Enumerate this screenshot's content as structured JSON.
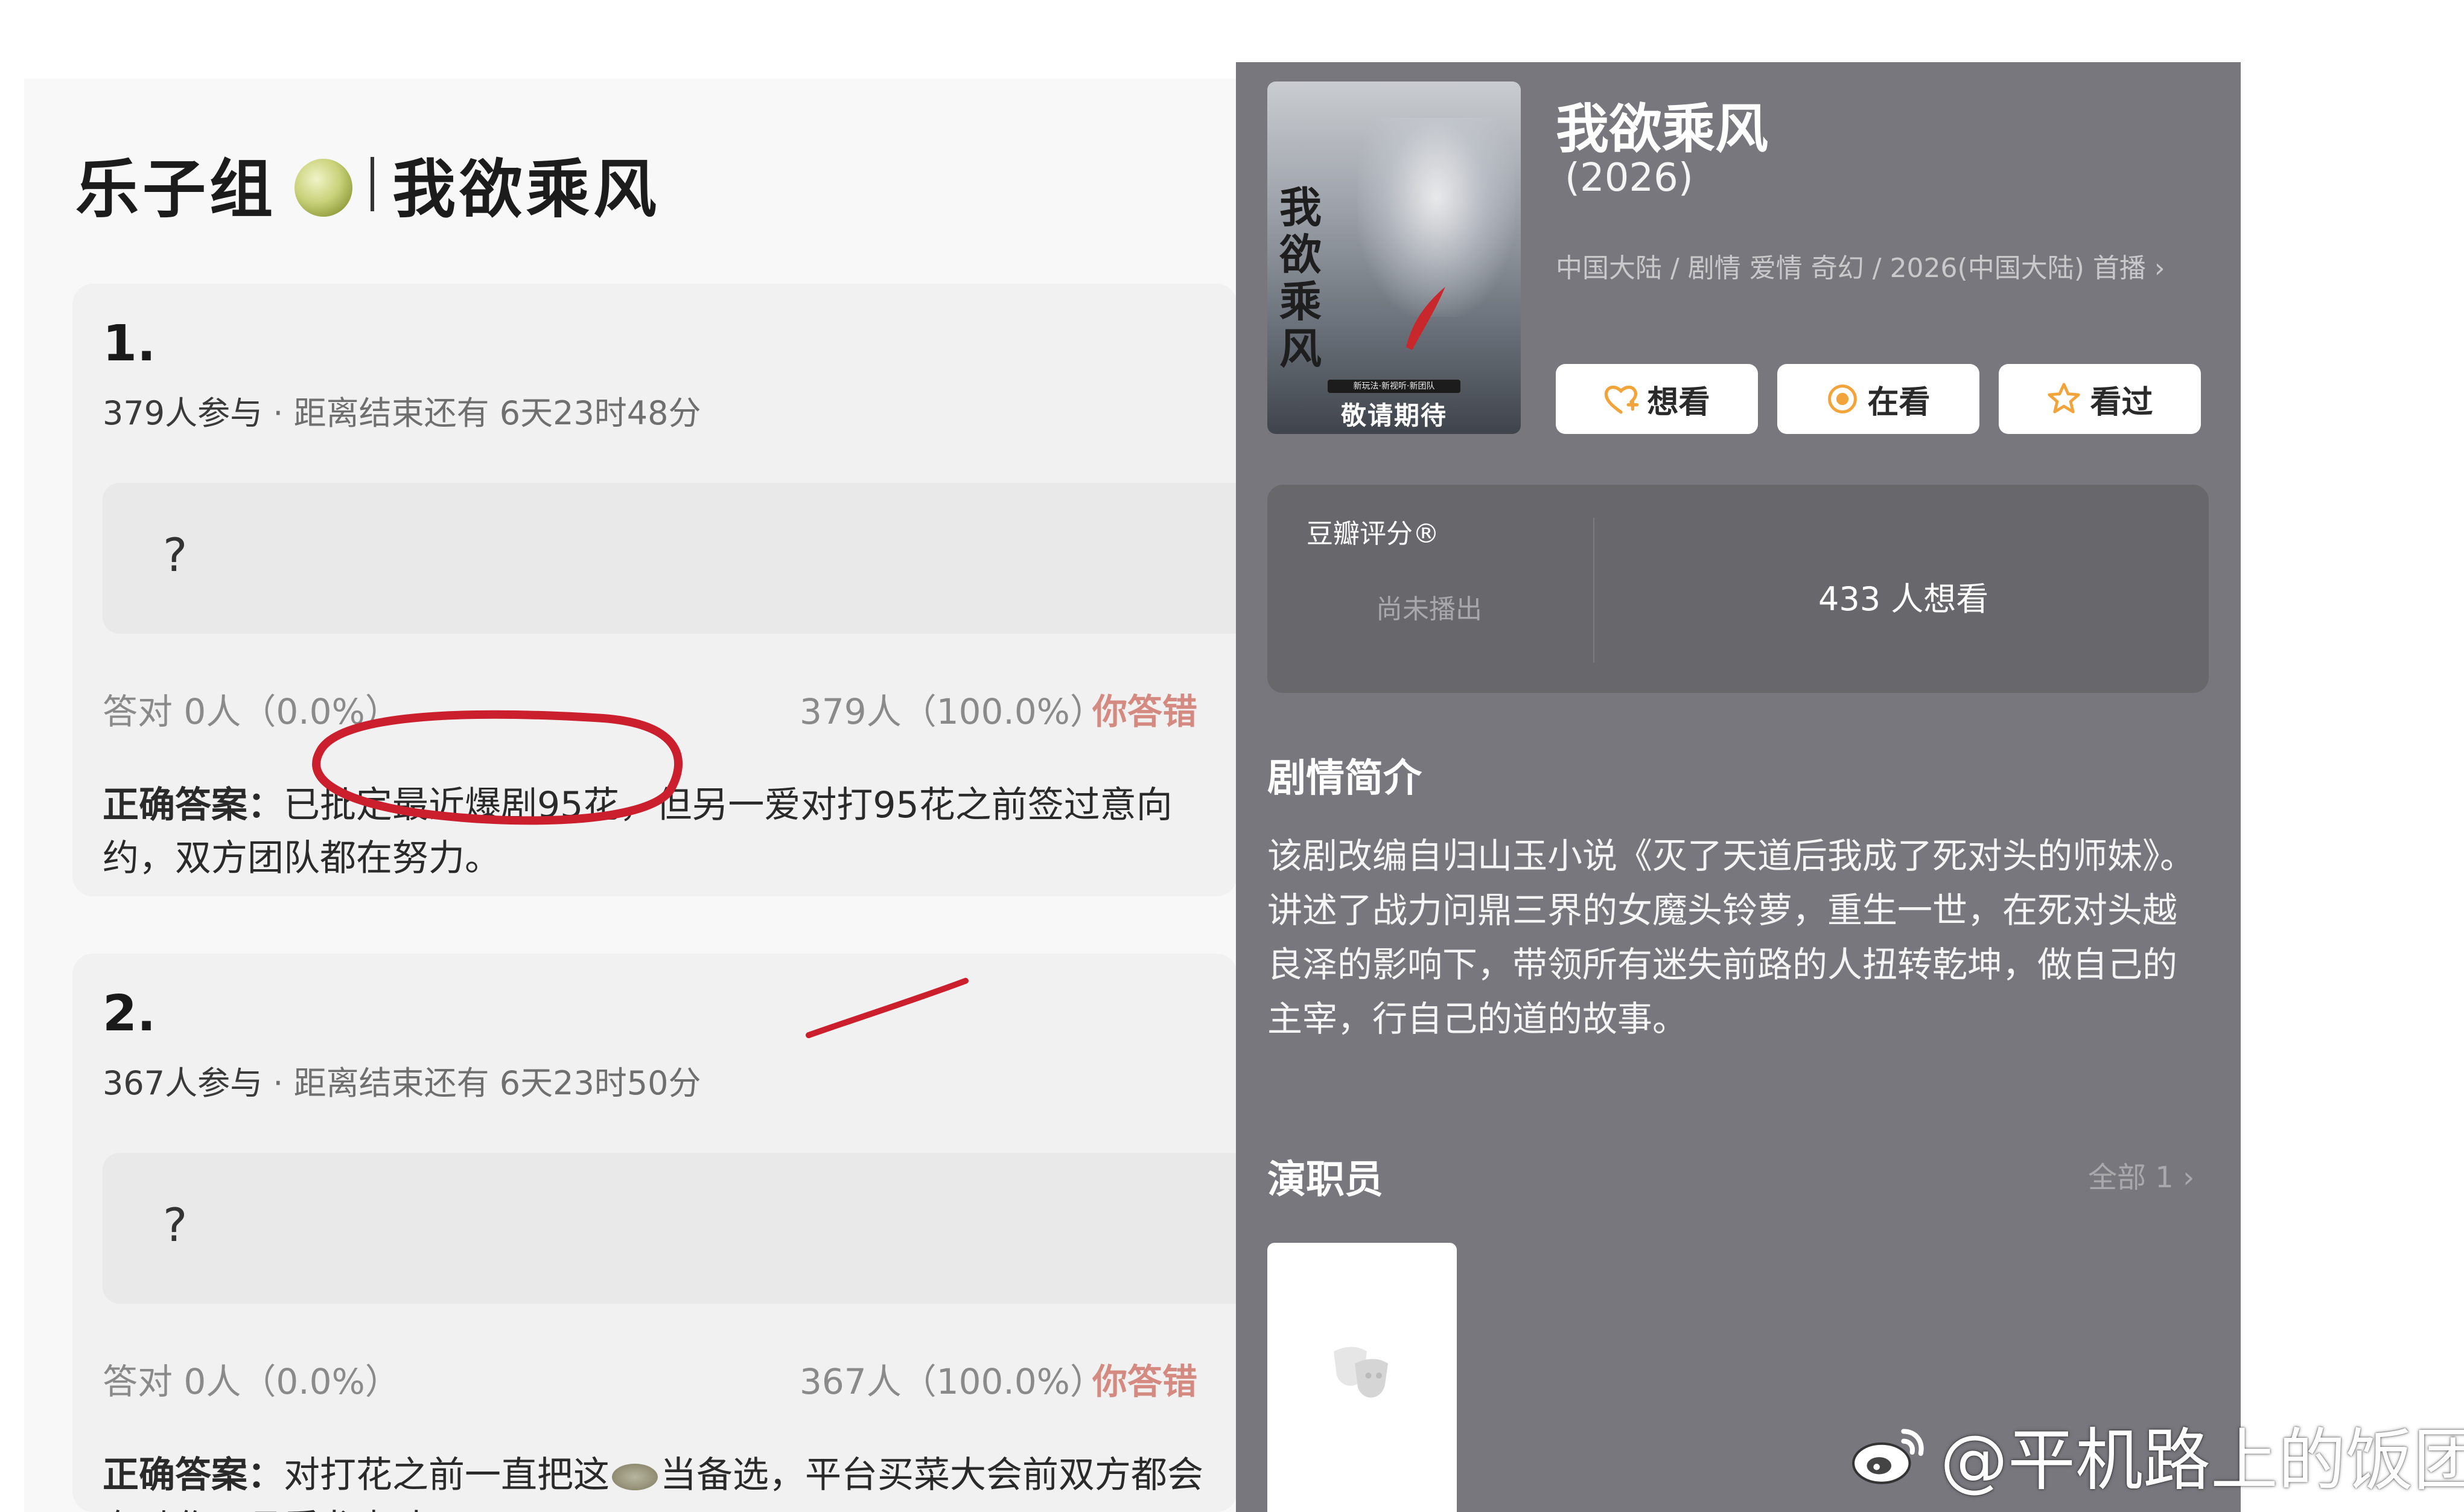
{
  "left": {
    "header": {
      "group_name": "乐子组",
      "drama_title": "我欲乘风"
    },
    "questions": [
      {
        "number": "1.",
        "participants": "379人参与",
        "separator": " · ",
        "deadline": "距离结束还有 6天23时48分",
        "question_text": "?",
        "correct_stats": "答对  0人（0.0%）",
        "wrong_stats": "379人（100.0%）",
        "wrong_label": "你答错",
        "answer_label": "正确答案：",
        "answer_text": "已批定最近爆剧95花，但另一爱对打95花之前签过意向约，双方团队都在努力。"
      },
      {
        "number": "2.",
        "participants": "367人参与",
        "separator": " · ",
        "deadline": "距离结束还有 6天23时50分",
        "question_text": "?",
        "correct_stats": "答对  0人（0.0%）",
        "wrong_stats": "367人（100.0%）",
        "wrong_label": "你答错",
        "answer_label": "正确答案：",
        "answer_text_a": "对打花之前一直把这",
        "answer_text_b": "当备选，平台买菜大会前双方都会有动作，且看龙虎斗"
      }
    ],
    "annotation_color": "#cc1f2d"
  },
  "right": {
    "poster": {
      "title": "我欲乘风",
      "tag": "新玩法·新视听·新团队",
      "coming": "敬请期待"
    },
    "title": "我欲乘风",
    "year": "(2026)",
    "info": "中国大陆 / 剧情 爱情 奇幻 / 2026(中国大陆) 首播",
    "buttons": [
      {
        "label": "想看",
        "icon": "heart-plus-icon"
      },
      {
        "label": "在看",
        "icon": "watching-circle-icon"
      },
      {
        "label": "看过",
        "icon": "star-outline-icon"
      }
    ],
    "icon_color": "#f2a33a",
    "rating": {
      "label": "豆瓣评分®",
      "status": "尚未播出",
      "want_count": "433 人想看"
    },
    "synopsis_heading": "剧情简介",
    "synopsis": "该剧改编自归山玉小说《灭了天道后我成了死对头的师妹》。讲述了战力问鼎三界的女魔头铃萝，重生一世，在死对头越良泽的影响下，带领所有迷失前路的人扭转乾坤，做自己的主宰，行自己的道的故事。",
    "cast_heading": "演职员",
    "cast_all": "全部 1"
  },
  "watermark": "@平机路上的饭团"
}
